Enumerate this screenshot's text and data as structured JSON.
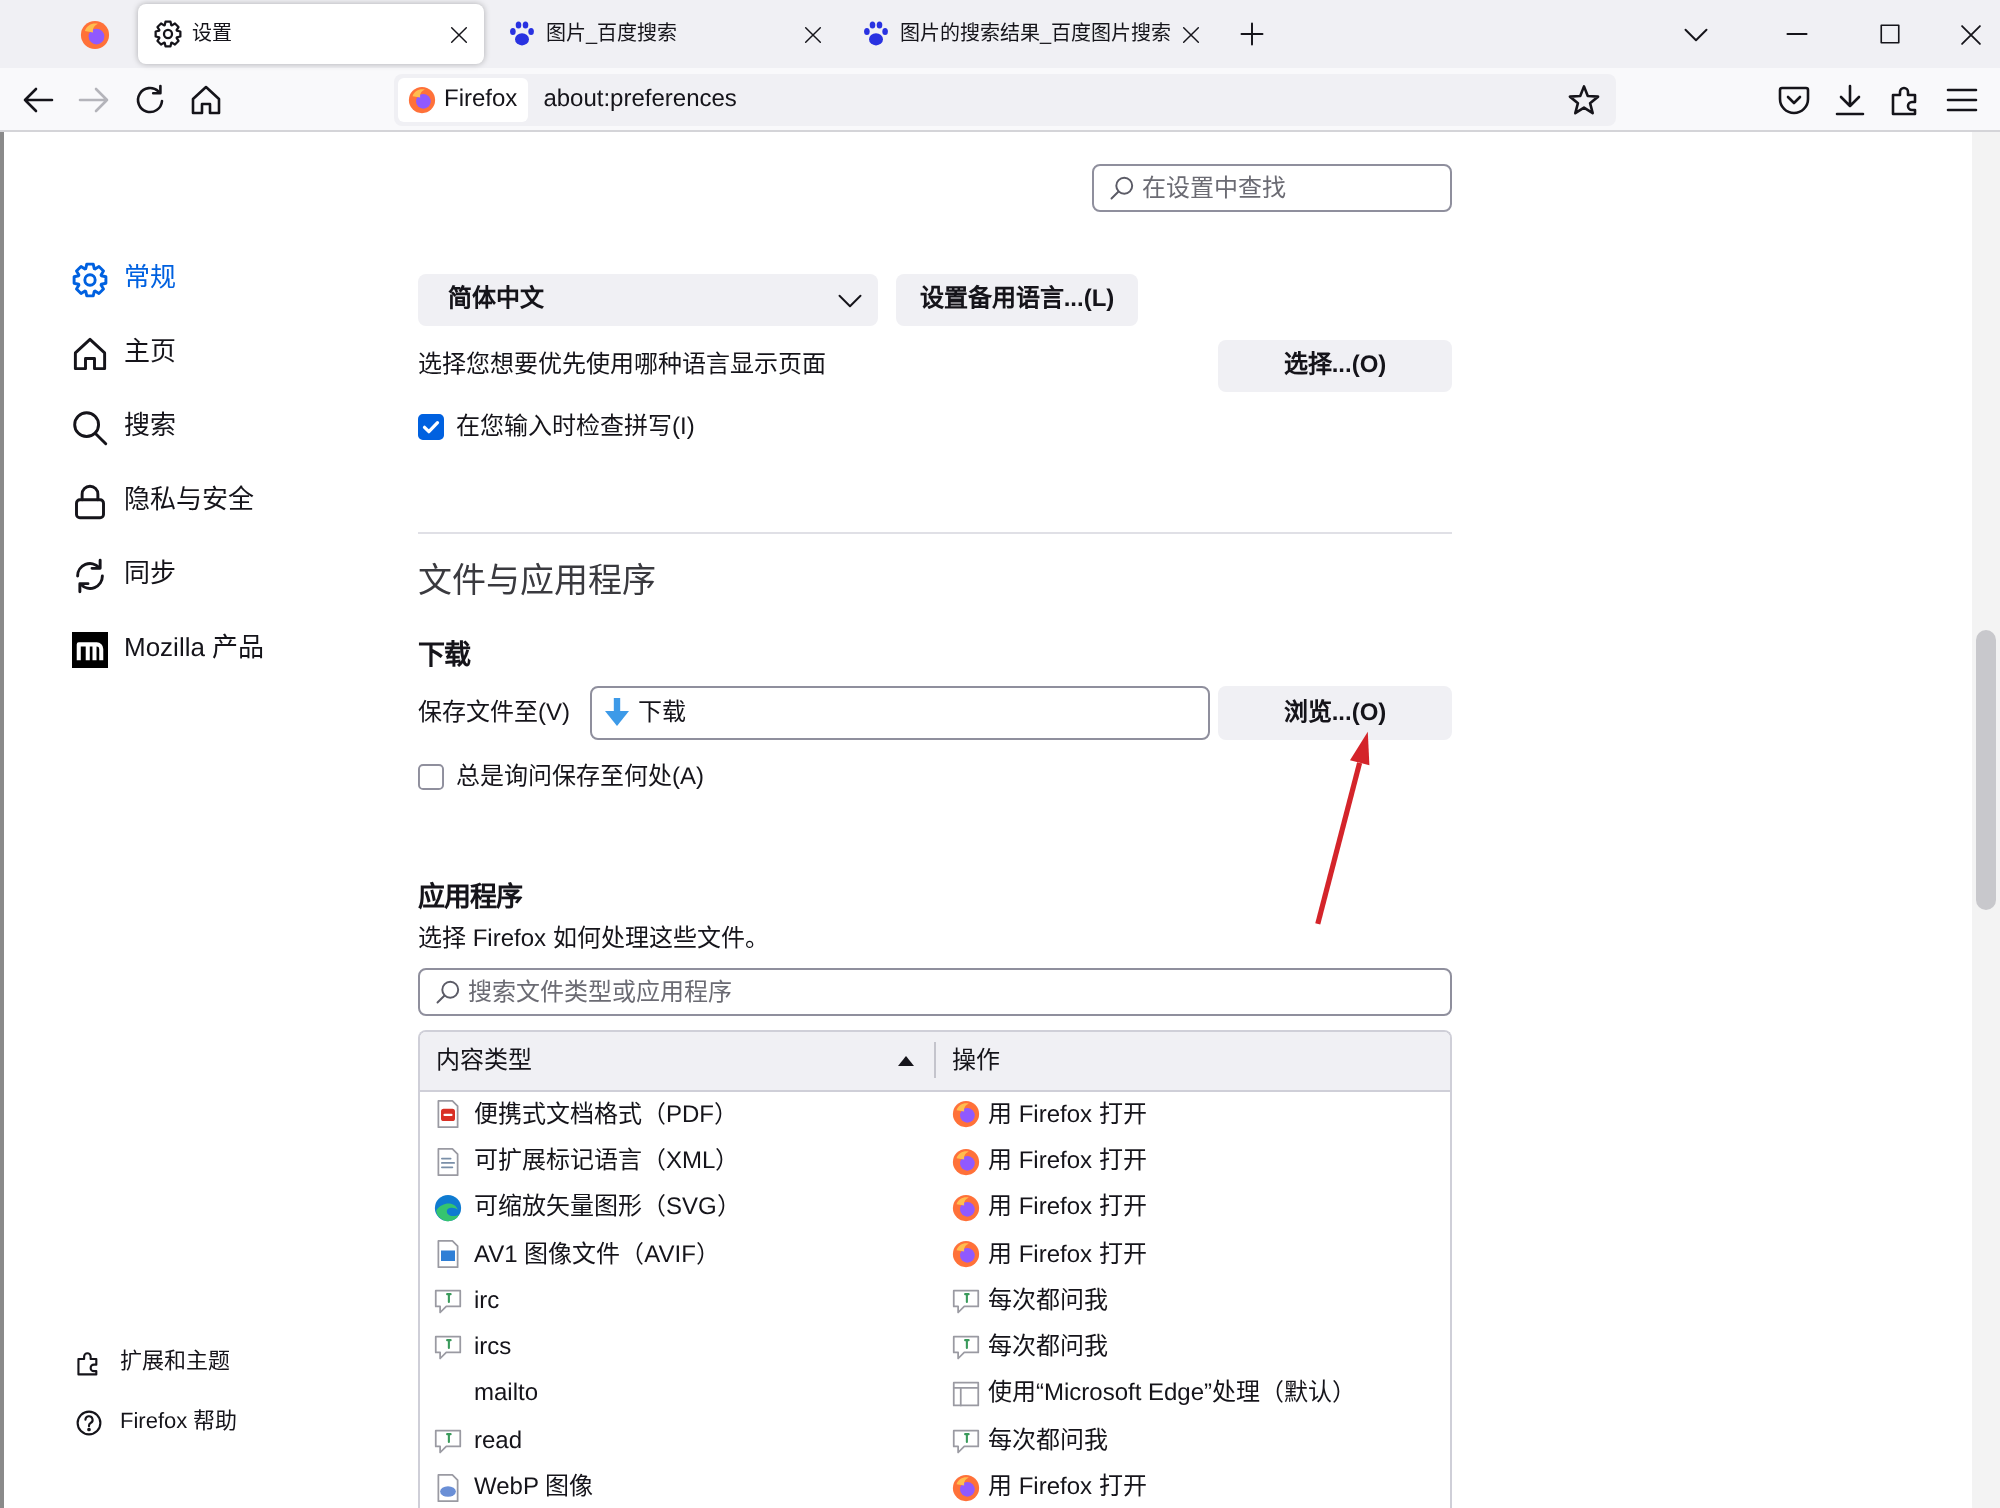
{
  "tabs": [
    {
      "kind": "pinned",
      "selected": false
    },
    {
      "kind": "settings",
      "label": "设置",
      "selected": true
    },
    {
      "kind": "web",
      "label": "图片_百度搜索",
      "selected": false
    },
    {
      "kind": "web",
      "label": "图片的搜索结果_百度图片搜索",
      "selected": false
    }
  ],
  "toolbar": {
    "buttons": [
      {
        "kind": "back",
        "disabled": false
      },
      {
        "kind": "forward",
        "disabled": true
      },
      {
        "kind": "reload",
        "disabled": false
      },
      {
        "kind": "home",
        "disabled": false
      }
    ],
    "identity": "Firefox",
    "url": "about:preferences",
    "tools": [
      {
        "kind": "pocket"
      },
      {
        "kind": "downloads"
      },
      {
        "kind": "extensions"
      },
      {
        "kind": "menu"
      }
    ]
  },
  "sidebar": {
    "items": [
      {
        "kind": "general",
        "label": "常规",
        "selected": true
      },
      {
        "kind": "home",
        "label": "主页",
        "selected": false
      },
      {
        "kind": "search",
        "label": "搜索",
        "selected": false
      },
      {
        "kind": "privacy",
        "label": "隐私与安全",
        "selected": false
      },
      {
        "kind": "sync",
        "label": "同步",
        "selected": false
      },
      {
        "kind": "mozilla",
        "label": "Mozilla 产品",
        "selected": false
      }
    ],
    "footer": [
      {
        "kind": "extensions",
        "label": "扩展和主题"
      },
      {
        "kind": "help",
        "label": "Firefox 帮助"
      }
    ]
  },
  "search": {
    "placeholder": "在设置中查找"
  },
  "language": {
    "value": "简体中文",
    "alternatives_button": "设置备用语言...(L)",
    "prompt": "选择您想要优先使用哪种语言显示页面",
    "choose_button": "选择...(O)",
    "spellcheck": {
      "label": "在您输入时检查拼写(I)",
      "checked": true
    }
  },
  "files": {
    "title": "文件与应用程序",
    "downloads": {
      "title": "下载",
      "save_label": "保存文件至(V)",
      "folder": "下载",
      "browse_button": "浏览...(O)",
      "always_ask": {
        "label": "总是询问保存至何处(A)",
        "checked": false
      }
    },
    "applications": {
      "title": "应用程序",
      "description": "选择 Firefox 如何处理这些文件。",
      "search_placeholder": "搜索文件类型或应用程序",
      "columns": [
        {
          "label": "内容类型",
          "sorted": true
        },
        {
          "label": "操作",
          "sorted": false
        }
      ],
      "rows": [
        {
          "content_type": {
            "kind": "pdf",
            "text": "便携式文档格式（PDF）"
          },
          "action": {
            "kind": "firefox",
            "text": "用 Firefox 打开"
          }
        },
        {
          "content_type": {
            "kind": "xml",
            "text": "可扩展标记语言（XML）"
          },
          "action": {
            "kind": "firefox",
            "text": "用 Firefox 打开"
          }
        },
        {
          "content_type": {
            "kind": "edge",
            "text": "可缩放矢量图形（SVG）"
          },
          "action": {
            "kind": "firefox",
            "text": "用 Firefox 打开"
          }
        },
        {
          "content_type": {
            "kind": "image",
            "text": "AV1 图像文件（AVIF）"
          },
          "action": {
            "kind": "firefox",
            "text": "用 Firefox 打开"
          }
        },
        {
          "content_type": {
            "kind": "ask",
            "text": "irc"
          },
          "action": {
            "kind": "ask",
            "text": "每次都问我"
          }
        },
        {
          "content_type": {
            "kind": "ask",
            "text": "ircs"
          },
          "action": {
            "kind": "ask",
            "text": "每次都问我"
          }
        },
        {
          "content_type": {
            "text": "mailto"
          },
          "action": {
            "kind": "app",
            "text": "使用“Microsoft Edge”处理（默认）"
          }
        },
        {
          "content_type": {
            "kind": "ask",
            "text": "read"
          },
          "action": {
            "kind": "ask",
            "text": "每次都问我"
          }
        },
        {
          "content_type": {
            "kind": "webp",
            "text": "WebP 图像"
          },
          "action": {
            "kind": "firefox",
            "text": "用 Firefox 打开"
          }
        }
      ]
    }
  },
  "annotation": {
    "kind": "arrow"
  }
}
